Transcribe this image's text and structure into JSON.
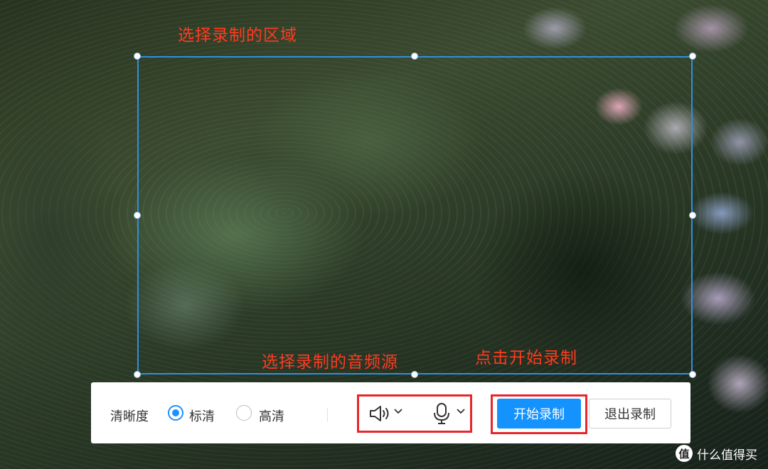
{
  "annotations": {
    "select_area": "选择录制的区域",
    "select_audio": "选择录制的音频源",
    "click_start": "点击开始录制"
  },
  "toolbar": {
    "quality_label": "清晰度",
    "quality_options": [
      {
        "label": "标清",
        "selected": true
      },
      {
        "label": "高清",
        "selected": false
      }
    ],
    "speaker_icon": "speaker-icon",
    "mic_icon": "microphone-icon",
    "start_label": "开始录制",
    "exit_label": "退出录制"
  },
  "colors": {
    "accent": "#1493ff",
    "annotation": "#ff3b1f",
    "highlight_box": "#e8262b",
    "selection_border": "#2f8fe0"
  },
  "watermark": {
    "logo": "值",
    "text": "什么值得买"
  }
}
